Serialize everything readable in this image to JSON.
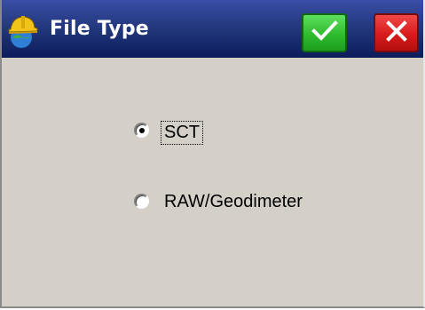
{
  "window": {
    "title": "File Type",
    "app_icon": "hardhat-surveyor-icon"
  },
  "titlebar_buttons": {
    "ok_icon": "checkmark-icon",
    "close_icon": "close-x-icon",
    "ok_color": "#2fbb2f",
    "close_color": "#d81b1b"
  },
  "options": {
    "selected": "SCT",
    "items": [
      {
        "label": "SCT",
        "checked": true
      },
      {
        "label": "RAW/Geodimeter",
        "checked": false
      }
    ]
  },
  "colors": {
    "titlebar": "#24397f",
    "background": "#d4d0c8"
  }
}
